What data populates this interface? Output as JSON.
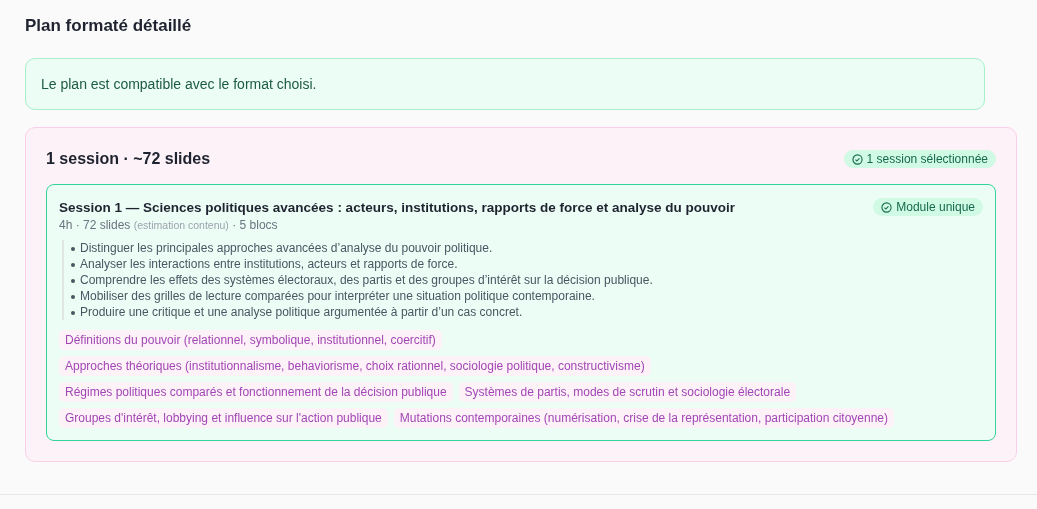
{
  "title": "Plan formaté détaillé",
  "notice": "Le plan est compatible avec le format choisi.",
  "summary": {
    "title": "1 session · ~72 slides",
    "badge": "1 session sélectionnée"
  },
  "sessions": [
    {
      "selected": true,
      "title": "Session 1 — Sciences politiques avancées : acteurs, institutions, rapports de force et analyse du pouvoir",
      "badge": "Module unique",
      "meta_start": "4h · 72 slides",
      "meta_note": "(estimation contenu)",
      "meta_end": "· 5 blocs",
      "objectives": [
        "Distinguer les principales approches avancées d’analyse du pouvoir politique.",
        "Analyser les interactions entre institutions, acteurs et rapports de force.",
        "Comprendre les effets des systèmes électoraux, des partis et des groupes d’intérêt sur la décision publique.",
        "Mobiliser des grilles de lecture comparées pour interpréter une situation politique contemporaine.",
        "Produire une critique et une analyse politique argumentée à partir d’un cas concret."
      ],
      "blocks": [
        "Définitions du pouvoir (relationnel, symbolique, institutionnel, coercitif)",
        "Approches théoriques (institutionnalisme, behaviorisme, choix rationnel, sociologie politique, constructivisme)",
        "Régimes politiques comparés et fonctionnement de la décision publique",
        "Systèmes de partis, modes de scrutin et sociologie électorale",
        "Groupes d'intérêt, lobbying et influence sur l'action publique",
        "Mutations contemporaines (numérisation, crise de la représentation, participation citoyenne)"
      ]
    }
  ]
}
